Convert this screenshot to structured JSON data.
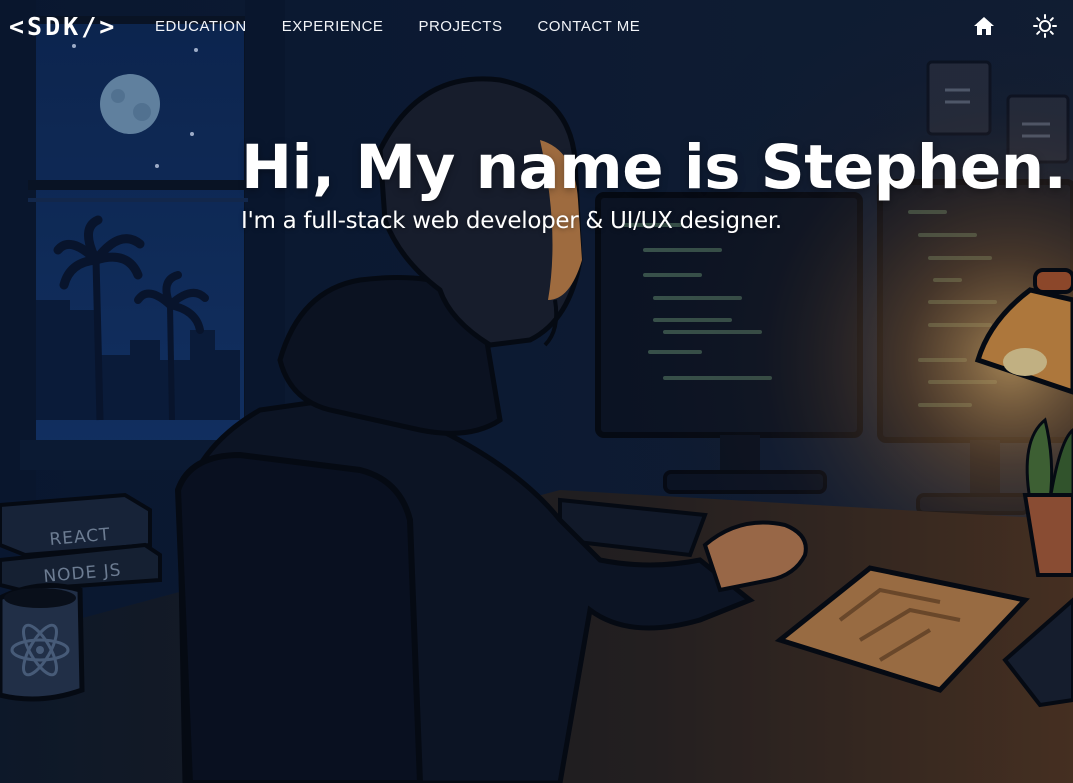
{
  "nav": {
    "logo": "<SDK/>",
    "links": [
      "EDUCATION",
      "EXPERIENCE",
      "PROJECTS",
      "CONTACT ME"
    ]
  },
  "hero": {
    "title": "Hi, My name is Stephen.",
    "subtitle": "I'm a full-stack web developer & UI/UX designer."
  },
  "scene": {
    "books": [
      "REACT",
      "NODE JS"
    ]
  },
  "icons": {
    "home": "home-icon",
    "theme": "sun-icon"
  },
  "colors": {
    "sky": "#0d2a5c",
    "wall": "#0b1a33",
    "lamp_glow": "#f3b558",
    "desk": "#3a2618",
    "text": "#ffffff"
  }
}
